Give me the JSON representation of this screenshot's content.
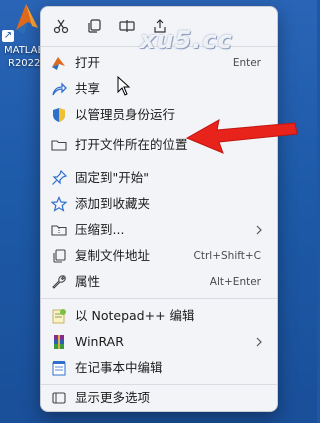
{
  "desktop": {
    "icon_label_line1": "MATLAB",
    "icon_label_line2": "R2022"
  },
  "watermark": "xu5.cc",
  "menu": {
    "toolbar_icons": [
      "cut-icon",
      "copy-icon",
      "rename-icon",
      "share-icon"
    ],
    "items": [
      {
        "label": "打开",
        "shortcut": "Enter",
        "icon": "open-app-icon"
      },
      {
        "label": "共享",
        "icon": "share-icon"
      },
      {
        "label": "以管理员身份运行",
        "icon": "shield-icon"
      },
      {
        "label": "打开文件所在的位置",
        "icon": "folder-icon"
      },
      {
        "label": "固定到\"开始\"",
        "icon": "pin-icon"
      },
      {
        "label": "添加到收藏夹",
        "icon": "star-icon"
      },
      {
        "label": "压缩到...",
        "icon": "zip-folder-icon",
        "submenu": true
      },
      {
        "label": "复制文件地址",
        "shortcut": "Ctrl+Shift+C",
        "icon": "copy-path-icon"
      },
      {
        "label": "属性",
        "shortcut": "Alt+Enter",
        "icon": "wrench-icon"
      },
      {
        "label": "以 Notepad++ 编辑",
        "icon": "notepadpp-icon"
      },
      {
        "label": "WinRAR",
        "icon": "winrar-icon",
        "submenu": true
      },
      {
        "label": "在记事本中编辑",
        "icon": "notepad-icon"
      },
      {
        "label": "显示更多选项",
        "icon": "more-options-icon"
      }
    ]
  },
  "colors": {
    "desktop_bg": "#1f56a6",
    "menu_bg": "#f2f4f8",
    "annotation_arrow": "#e8231c"
  }
}
